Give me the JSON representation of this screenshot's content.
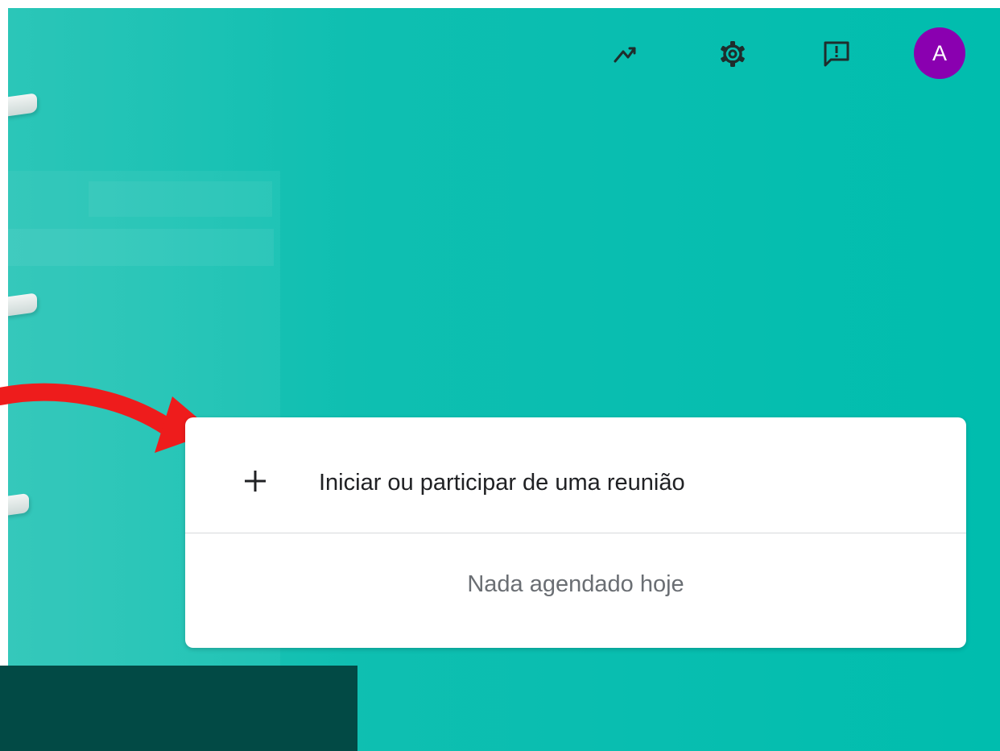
{
  "header": {
    "icons": {
      "activity": "trending-icon",
      "settings": "gear-icon",
      "feedback": "feedback-icon"
    },
    "avatar_letter": "A",
    "avatar_color": "#8a00b0"
  },
  "meeting_card": {
    "action_label": "Iniciar ou participar de uma reunião",
    "action_icon": "plus-icon",
    "empty_state": "Nada agendado hoje"
  },
  "colors": {
    "background": "#00bdae",
    "annotation_arrow": "#ee1c1c",
    "dark_block": "#024a45"
  }
}
